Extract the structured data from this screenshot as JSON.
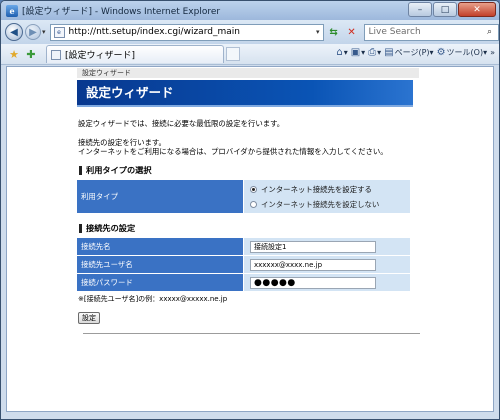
{
  "window": {
    "title": "[設定ウィザード] - Windows Internet Explorer",
    "icon": "ie-logo-icon",
    "buttons": {
      "minimize": "–",
      "maximize": "□",
      "close": "✕"
    }
  },
  "browser": {
    "url": "http://ntt.setup/index.cgi/wizard_main",
    "search_placeholder": "Live Search",
    "tab_title": "[設定ウィザード]",
    "commands": {
      "page": "ページ(P)",
      "tools": "ツール(O)"
    }
  },
  "page": {
    "breadcrumb": "設定ウィザード",
    "banner_title": "設定ウィザード",
    "intro": "設定ウィザードでは、接続に必要な最低限の設定を行います。",
    "lead_1": "接続先の設定を行います。",
    "lead_2": "インターネットをご利用になる場合は、プロバイダから提供された情報を入力してください。",
    "usage": {
      "heading": "利用タイプの選択",
      "label": "利用タイプ",
      "options": [
        {
          "label": "インターネット接続先を設定する",
          "selected": true
        },
        {
          "label": "インターネット接続先を設定しない",
          "selected": false
        }
      ]
    },
    "connection": {
      "heading": "接続先の設定",
      "rows": [
        {
          "label": "接続先名",
          "value": "接続設定1"
        },
        {
          "label": "接続先ユーザ名",
          "value": "xxxxxx@xxxx.ne.jp"
        },
        {
          "label": "接続パスワード",
          "value": "●●●●●"
        }
      ]
    },
    "note": "※[接続先ユーザ名]の例：xxxxx@xxxxx.ne.jp",
    "apply_label": "設定"
  }
}
